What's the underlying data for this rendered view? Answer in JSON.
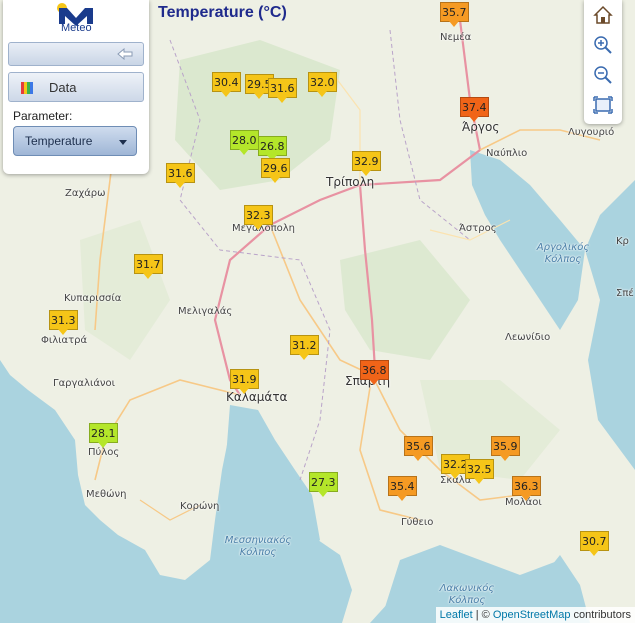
{
  "title": "Temperature (°C)",
  "logo": {
    "text": "Meteo"
  },
  "panel": {
    "data_label": "Data",
    "parameter_label": "Parameter:",
    "parameter_value": "Temperature"
  },
  "attribution": {
    "leaflet": "Leaflet",
    "separator": " | © ",
    "osm": "OpenStreetMap",
    "suffix": " contributors"
  },
  "colors": {
    "hot": "#f06418",
    "warm": "#f59a23",
    "mild": "#f5c518",
    "cool": "#b4e62a",
    "sea": "#aad3df",
    "land": "#eef0e4"
  },
  "places": {
    "nemea": "Νεμέα",
    "argos": "Άργος",
    "nafplio": "Ναύπλιο",
    "lygourio": "Λυγουριό",
    "zacharo": "Ζαχάρω",
    "tripoli": "Τρίπολη",
    "megalopoli": "Μεγαλόπολη",
    "astros": "Άστρος",
    "argolic_gulf": "Αργολικός\nΚόλπος",
    "spetses": "Σπέ",
    "kyparissia": "Κυπαρισσία",
    "meligalas": "Μελιγαλάς",
    "leonidio": "Λεωνίδιο",
    "filiatra": "Φιλιατρά",
    "gargalianoi": "Γαργαλιάνοι",
    "sparti": "Σπάρτη",
    "kalamata": "Καλαμάτα",
    "pylos": "Πύλος",
    "skala": "Σκάλα",
    "methoni": "Μεθώνη",
    "molaoi": "Μολάοι",
    "koroni": "Κορώνη",
    "gytheio": "Γύθειο",
    "messinian_gulf": "Μεσσηνιακός\nΚόλπος",
    "laconian_gulf": "Λακωνικός\nΚόλπος",
    "kr": "Κρ"
  },
  "markers": [
    {
      "v": "35.7",
      "c": "warm"
    },
    {
      "v": "30.4",
      "c": "mild"
    },
    {
      "v": "29.5",
      "c": "mild"
    },
    {
      "v": "31.6",
      "c": "mild"
    },
    {
      "v": "32.0",
      "c": "mild"
    },
    {
      "v": "37.4",
      "c": "hot"
    },
    {
      "v": "28.0",
      "c": "cool"
    },
    {
      "v": "26.8",
      "c": "cool"
    },
    {
      "v": "29.6",
      "c": "mild"
    },
    {
      "v": "32.9",
      "c": "mild"
    },
    {
      "v": "31.6",
      "c": "mild"
    },
    {
      "v": "32.3",
      "c": "mild"
    },
    {
      "v": "31.7",
      "c": "mild"
    },
    {
      "v": "31.3",
      "c": "mild"
    },
    {
      "v": "31.2",
      "c": "mild"
    },
    {
      "v": "36.8",
      "c": "hot"
    },
    {
      "v": "31.9",
      "c": "mild"
    },
    {
      "v": "28.1",
      "c": "cool"
    },
    {
      "v": "35.6",
      "c": "warm"
    },
    {
      "v": "35.9",
      "c": "warm"
    },
    {
      "v": "32.2",
      "c": "mild"
    },
    {
      "v": "32.5",
      "c": "mild"
    },
    {
      "v": "27.3",
      "c": "cool"
    },
    {
      "v": "35.4",
      "c": "warm"
    },
    {
      "v": "36.3",
      "c": "warm"
    },
    {
      "v": "30.7",
      "c": "mild"
    }
  ]
}
